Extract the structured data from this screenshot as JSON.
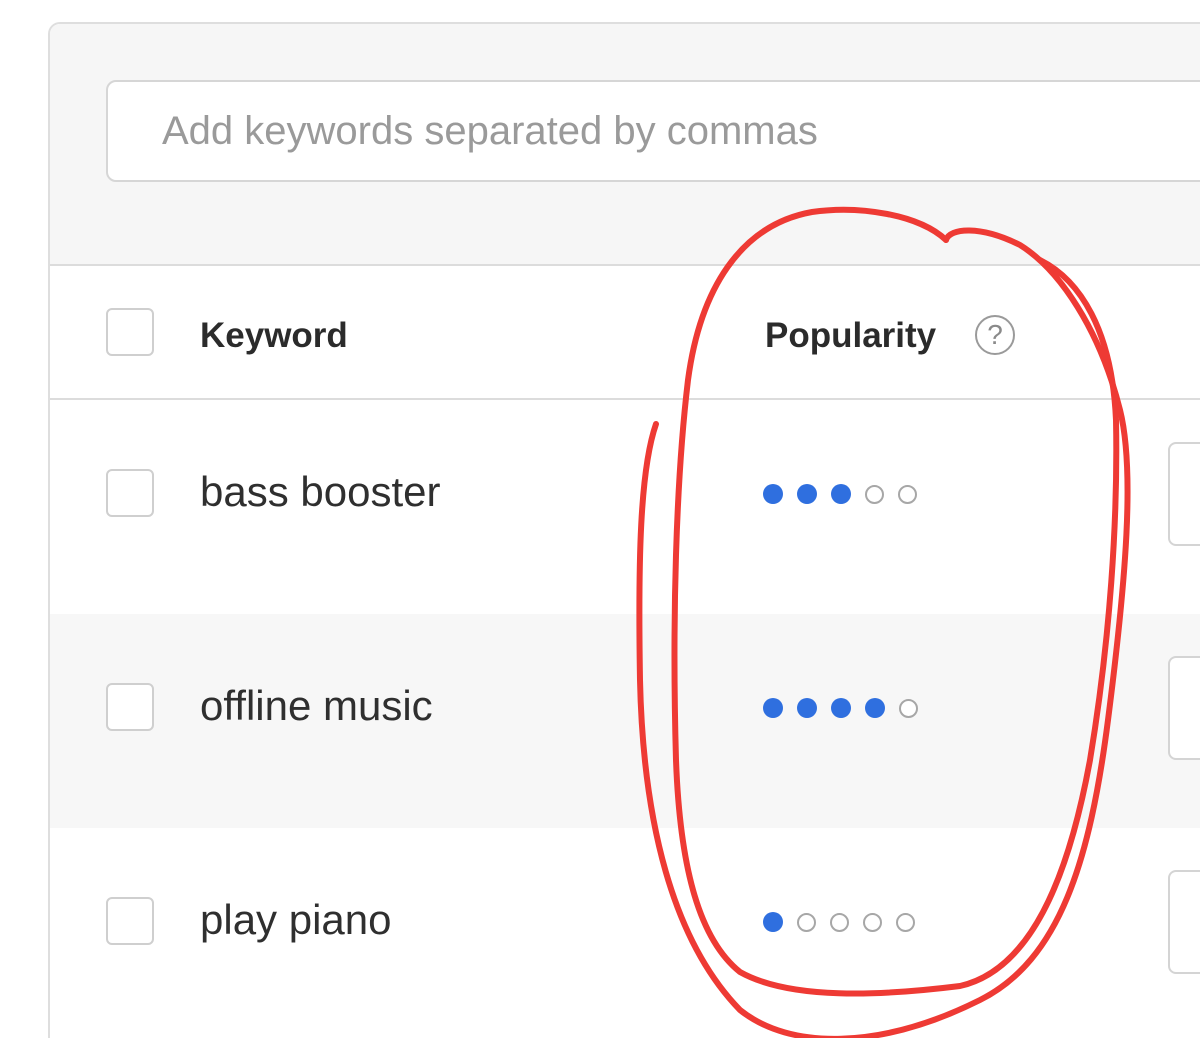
{
  "search": {
    "placeholder": "Add keywords separated by commas",
    "value": ""
  },
  "table": {
    "headers": {
      "keyword": "Keyword",
      "popularity": "Popularity",
      "help_glyph": "?"
    },
    "popularity_max": 5,
    "rows": [
      {
        "keyword": "bass booster",
        "popularity": 3
      },
      {
        "keyword": "offline music",
        "popularity": 4
      },
      {
        "keyword": "play piano",
        "popularity": 1
      }
    ]
  },
  "colors": {
    "dot_active": "#2f6fdf",
    "dot_inactive": "#a7a7a7",
    "annotation": "#ee3a34"
  },
  "annotation": {
    "type": "hand-drawn-circle",
    "encloses": "popularity-column"
  }
}
